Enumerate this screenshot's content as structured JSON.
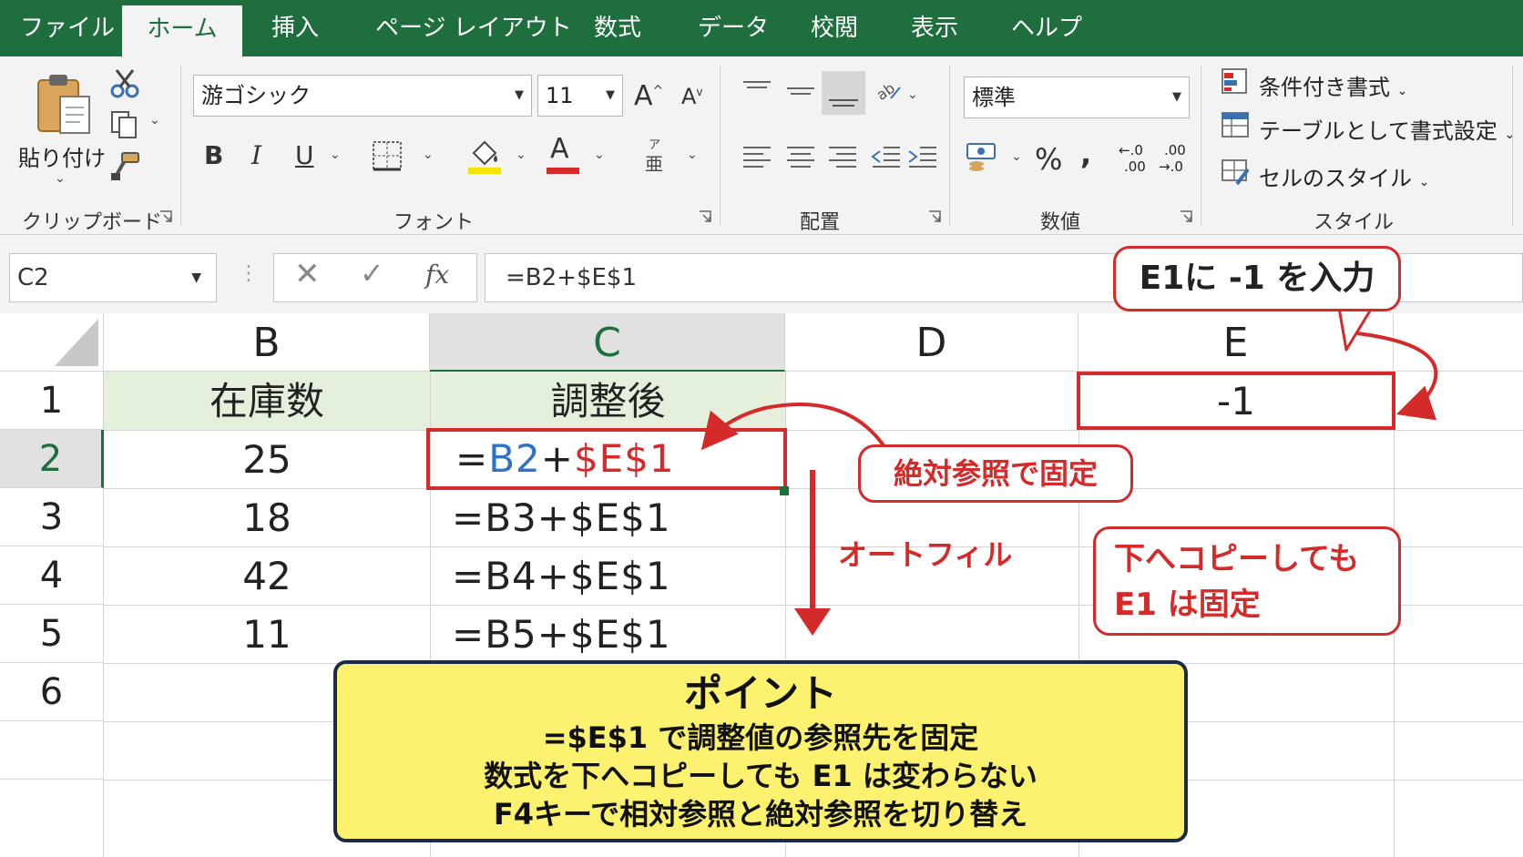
{
  "colors": {
    "excel_green": "#1e6e3e",
    "callout_red": "#d42a2a",
    "ref_blue": "#2f73c8",
    "point_yellow": "#fcf26f",
    "header_fill": "#e4f0dc"
  },
  "menu": {
    "tabs": [
      "ファイル",
      "ホーム",
      "挿入",
      "ページ レイアウト",
      "数式",
      "データ",
      "校閲",
      "表示",
      "ヘルプ"
    ],
    "active": "ホーム"
  },
  "ribbon": {
    "clipboard": {
      "paste_label": "貼り付け",
      "group_label": "クリップボード"
    },
    "font": {
      "font_name": "游ゴシック",
      "font_size": "11",
      "bold": "B",
      "italic": "I",
      "underline": "U",
      "font_color_glyph": "A",
      "phonetic_top": "ア",
      "phonetic_bottom": "亜",
      "grow": "A",
      "shrink": "A",
      "group_label": "フォント"
    },
    "alignment": {
      "group_label": "配置"
    },
    "number": {
      "format": "標準",
      "percent": "%",
      "comma": ",",
      "inc_decimal_top": "←.0",
      "inc_decimal_bottom": ".00",
      "dec_decimal_top": ".00",
      "dec_decimal_bottom": "→.0",
      "group_label": "数値"
    },
    "styles": {
      "conditional": "条件付き書式",
      "as_table": "テーブルとして書式設定",
      "cell_styles": "セルのスタイル",
      "group_label": "スタイル"
    }
  },
  "formula_bar": {
    "name_box": "C2",
    "fx": "fx",
    "formula": "=B2+$E$1"
  },
  "columns": [
    "B",
    "C",
    "D",
    "E"
  ],
  "rows": [
    "1",
    "2",
    "3",
    "4",
    "5",
    "6"
  ],
  "cells": {
    "b1": "在庫数",
    "c1": "調整後",
    "e1": "-1",
    "b": [
      "25",
      "18",
      "42",
      "11"
    ],
    "c_rows": [
      "=B3+$E$1",
      "=B4+$E$1",
      "=B5+$E$1"
    ],
    "c2": {
      "eq": "=",
      "ref": "B2",
      "plus": "+",
      "abs": "$E$1"
    }
  },
  "callouts": {
    "e1_input": "E1に -1 を入力",
    "absolute": "絶対参照で固定",
    "autofill": "オートフィル",
    "copy_line1": "下へコピーしても",
    "copy_line2": "E1 は固定"
  },
  "point": {
    "title": "ポイント",
    "lines": [
      "=$E$1 で調整値の参照先を固定",
      "数式を下へコピーしても E1 は変わらない",
      "F4キーで相対参照と絶対参照を切り替え"
    ]
  }
}
